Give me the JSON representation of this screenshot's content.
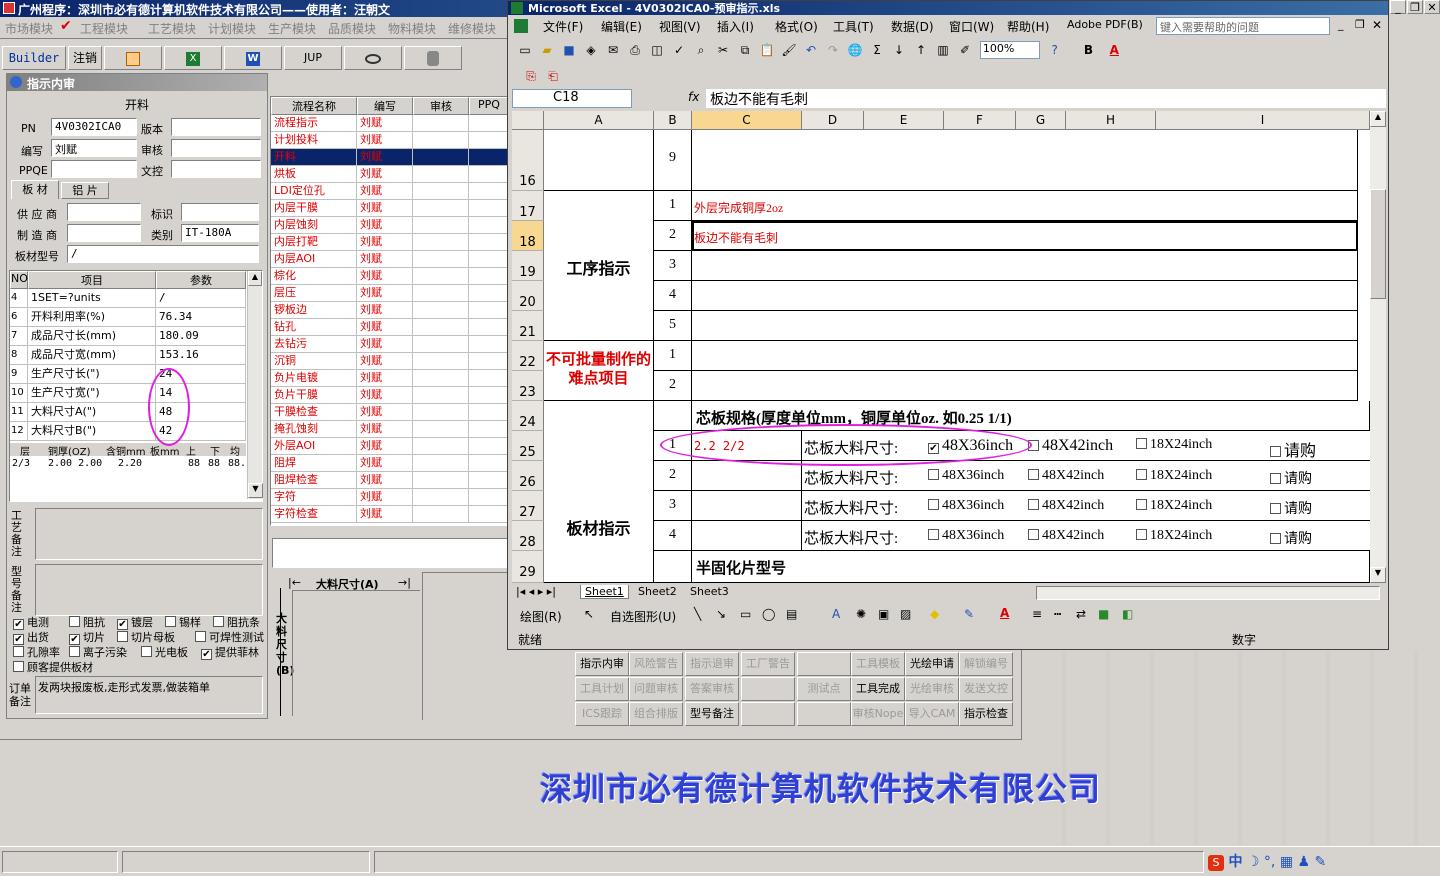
{
  "app": {
    "title": "广州程序：深圳市必有德计算机软件技术有限公司——使用者：汪朝文",
    "modules": [
      "市场模块",
      "工程模块",
      "工艺模块",
      "计划模块",
      "生产模块",
      "品质模块",
      "物料模块",
      "维修模块"
    ],
    "toolbar": [
      "Builder",
      "注销",
      "",
      "",
      "W",
      "JUP",
      "",
      ""
    ],
    "footer_company": "深圳市必有德计算机软件技术有限公司"
  },
  "panel": {
    "title": "指示内审",
    "group_title": "开料",
    "fields": {
      "pn_label": "PN",
      "pn": "4V0302ICA0",
      "version_label": "版本",
      "version": "",
      "author_label": "编写",
      "author": "刘赋",
      "review_label": "审核",
      "review": "",
      "ppqe_label": "PPQE",
      "ppqe": "",
      "doc_label": "文控",
      "doc": ""
    },
    "tabs": [
      "板 材",
      "铝 片"
    ],
    "material": {
      "supplier_label": "供 应 商",
      "supplier": "",
      "mark_label": "标识",
      "mark": "",
      "maker_label": "制 造 商",
      "maker": "",
      "type_label": "类别",
      "type": "IT-180A",
      "model_label": "板材型号",
      "model": "/"
    },
    "param_headers": [
      "NO",
      "项目",
      "参数"
    ],
    "params": [
      {
        "no": "4",
        "item": "1SET=?units",
        "val": "/"
      },
      {
        "no": "6",
        "item": "开料利用率(%)",
        "val": "76.34"
      },
      {
        "no": "7",
        "item": "成品尺寸长(mm)",
        "val": "180.09"
      },
      {
        "no": "8",
        "item": "成品尺寸宽(mm)",
        "val": "153.16"
      },
      {
        "no": "9",
        "item": "生产尺寸长(\")",
        "val": "24"
      },
      {
        "no": "10",
        "item": "生产尺寸宽(\")",
        "val": "14"
      },
      {
        "no": "11",
        "item": "大料尺寸A(\")",
        "val": "48"
      },
      {
        "no": "12",
        "item": "大料尺寸B(\")",
        "val": "42"
      }
    ],
    "layer_headers": [
      "层",
      "铜厚(OZ)",
      "含铜mm",
      "板mm",
      "上",
      "下",
      "均"
    ],
    "layer_row": [
      "2/3",
      "2.00 2.00",
      "2.20",
      "",
      "88",
      "88",
      "88."
    ],
    "craft_note_label": "工艺备注",
    "model_note_label": "型号备注",
    "checkboxes": [
      {
        "label": "电测",
        "checked": true
      },
      {
        "label": "阻抗",
        "checked": false
      },
      {
        "label": "镀层",
        "checked": true
      },
      {
        "label": "锡样",
        "checked": false
      },
      {
        "label": "阻抗条",
        "checked": false
      },
      {
        "label": "出货",
        "checked": true
      },
      {
        "label": "切片",
        "checked": true
      },
      {
        "label": "切片母板",
        "checked": false
      },
      {
        "label": "可焊性测试",
        "checked": false
      },
      {
        "label": "孔隙率",
        "checked": false
      },
      {
        "label": "离子污染",
        "checked": false
      },
      {
        "label": "光电板",
        "checked": false
      },
      {
        "label": "提供菲林",
        "checked": true
      },
      {
        "label": "顾客提供板材",
        "checked": false
      }
    ],
    "order_note_label": "订单备注",
    "order_note": "发两块报废板,走形式发票,做装箱单"
  },
  "flow": {
    "headers": [
      "流程名称",
      "编写",
      "审核",
      "PPQ"
    ],
    "rows": [
      {
        "name": "流程指示",
        "author": "刘赋"
      },
      {
        "name": "计划投料",
        "author": "刘赋"
      },
      {
        "name": "开料",
        "author": "刘赋",
        "selected": true
      },
      {
        "name": "烘板",
        "author": "刘赋"
      },
      {
        "name": "LDI定位孔",
        "author": "刘赋"
      },
      {
        "name": "内层干膜",
        "author": "刘赋"
      },
      {
        "name": "内层蚀刻",
        "author": "刘赋"
      },
      {
        "name": "内层打靶",
        "author": "刘赋"
      },
      {
        "name": "内层AOI",
        "author": "刘赋"
      },
      {
        "name": "棕化",
        "author": "刘赋"
      },
      {
        "name": "层压",
        "author": "刘赋"
      },
      {
        "name": "锣板边",
        "author": "刘赋"
      },
      {
        "name": "钻孔",
        "author": "刘赋"
      },
      {
        "name": "去钻污",
        "author": "刘赋"
      },
      {
        "name": "沉铜",
        "author": "刘赋"
      },
      {
        "name": "负片电镀",
        "author": "刘赋"
      },
      {
        "name": "负片干膜",
        "author": "刘赋"
      },
      {
        "name": "干膜检查",
        "author": "刘赋"
      },
      {
        "name": "掩孔蚀刻",
        "author": "刘赋"
      },
      {
        "name": "外层AOI",
        "author": "刘赋"
      },
      {
        "name": "阻焊",
        "author": "刘赋"
      },
      {
        "name": "阻焊检查",
        "author": "刘赋"
      },
      {
        "name": "字符",
        "author": "刘赋"
      },
      {
        "name": "字符检查",
        "author": "刘赋"
      }
    ],
    "size_a_label": "大料尺寸(A)",
    "size_b_label": "大料尺寸(B)"
  },
  "buttons": [
    {
      "label": "指示内审",
      "enabled": true
    },
    {
      "label": "风险警告",
      "enabled": false
    },
    {
      "label": "指示退审",
      "enabled": false
    },
    {
      "label": "工厂警告",
      "enabled": false
    },
    {
      "label": "",
      "enabled": false
    },
    {
      "label": "工具模板",
      "enabled": false
    },
    {
      "label": "光绘申请",
      "enabled": true
    },
    {
      "label": "解锁编号",
      "enabled": false
    },
    {
      "label": "工具计划",
      "enabled": false
    },
    {
      "label": "问题审核",
      "enabled": false
    },
    {
      "label": "答案审核",
      "enabled": false
    },
    {
      "label": "",
      "enabled": false
    },
    {
      "label": "测试点",
      "enabled": false
    },
    {
      "label": "工具完成",
      "enabled": true
    },
    {
      "label": "光绘审核",
      "enabled": false
    },
    {
      "label": "发送文控",
      "enabled": false
    },
    {
      "label": "ICS跟踪",
      "enabled": false
    },
    {
      "label": "组合排版",
      "enabled": false
    },
    {
      "label": "型号备注",
      "enabled": true
    },
    {
      "label": "",
      "enabled": false
    },
    {
      "label": "",
      "enabled": false
    },
    {
      "label": "审核Nope",
      "enabled": false
    },
    {
      "label": "导入CAM",
      "enabled": false
    },
    {
      "label": "指示检查",
      "enabled": true
    }
  ],
  "excel": {
    "title": "Microsoft Excel - 4V0302ICA0-预审指示.xls",
    "menus": [
      "文件(F)",
      "编辑(E)",
      "视图(V)",
      "插入(I)",
      "格式(O)",
      "工具(T)",
      "数据(D)",
      "窗口(W)",
      "帮助(H)",
      "Adobe PDF(B)"
    ],
    "help_placeholder": "键入需要帮助的问题",
    "zoom": "100%",
    "name_box": "C18",
    "formula": "板边不能有毛刺",
    "columns": [
      "A",
      "B",
      "C",
      "D",
      "E",
      "F",
      "G",
      "H",
      "I"
    ],
    "rows": [
      "16",
      "17",
      "18",
      "19",
      "20",
      "21",
      "22",
      "23",
      "24",
      "25",
      "26",
      "27",
      "28",
      "29"
    ],
    "cells": {
      "r16_b": "9",
      "r17_b": "1",
      "r17_c": "外层完成铜厚2oz",
      "r18_b": "2",
      "r18_c": "板边不能有毛刺",
      "r19_b": "3",
      "r20_b": "4",
      "r21_b": "5",
      "r22_b": "1",
      "r23_b": "2",
      "section_process": "工序指示",
      "section_difficult": "不可批量制作的难点项目",
      "core_spec": "芯板规格(厚度单位mm，铜厚单位oz. 如0.25 1/1)",
      "r25_b": "1",
      "r25_c": "2.2 2/2",
      "r26_b": "2",
      "r27_b": "3",
      "r28_b": "4",
      "section_board": "板材指示",
      "core_size_label": "芯板大料尺寸:",
      "opt1": "48X36inch",
      "opt2": "48X42inch",
      "opt3": "18X24inch",
      "opt4": "请购",
      "prepreg": "半固化片型号"
    },
    "sheets": [
      "Sheet1",
      "Sheet2",
      "Sheet3"
    ],
    "draw_label": "绘图(R)",
    "autoshape_label": "自选图形(U)",
    "status_ready": "就绪",
    "status_num": "数字"
  }
}
